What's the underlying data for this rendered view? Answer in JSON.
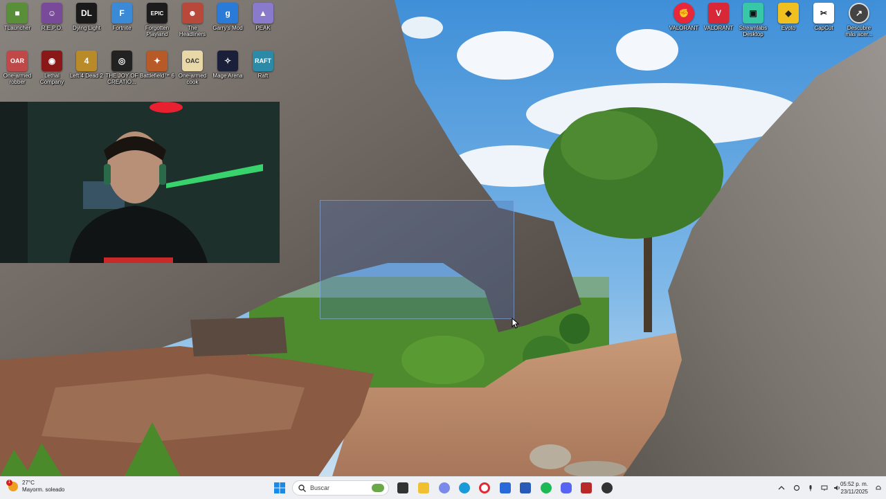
{
  "desktop": {
    "icons": [
      {
        "label": "TLauncher",
        "icon": "tlauncher-icon",
        "color": "#5a8f3a"
      },
      {
        "label": "R.E.P.O.",
        "icon": "repo-icon",
        "color": "#7a4a9a"
      },
      {
        "label": "Dying Light",
        "icon": "dying-light-icon",
        "color": "#1a1a1a"
      },
      {
        "label": "Fortnite",
        "icon": "fortnite-icon",
        "color": "#3a8ad8"
      },
      {
        "label": "Forgotten\nPlayland",
        "icon": "forgotten-playland-icon",
        "color": "#1c1c1c"
      },
      {
        "label": "The\nHeadliners",
        "icon": "the-headliners-icon",
        "color": "#b8483a"
      },
      {
        "label": "Garry's Mod",
        "icon": "garrys-mod-icon",
        "color": "#2a7ad8"
      },
      {
        "label": "PEAK",
        "icon": "peak-icon",
        "color": "#8a7acc"
      },
      {
        "label": "One-armed\nrobber",
        "icon": "one-armed-robber-icon",
        "color": "#c04848"
      },
      {
        "label": "Lethal\nCompany",
        "icon": "lethal-company-icon",
        "color": "#8a1818"
      },
      {
        "label": "Left 4 Dead 2",
        "icon": "left4dead2-icon",
        "color": "#b88a28"
      },
      {
        "label": "THE JOY OF\nCREATIO...",
        "icon": "joy-of-creation-icon",
        "color": "#222222"
      },
      {
        "label": "Battlefield™ 6",
        "icon": "battlefield6-icon",
        "color": "#b85a28"
      },
      {
        "label": "One-armed\ncook",
        "icon": "one-armed-cook-icon",
        "color": "#e8d8a8"
      },
      {
        "label": "Mage Arena",
        "icon": "mage-arena-icon",
        "color": "#1a1f3a"
      },
      {
        "label": "Raft",
        "icon": "raft-icon",
        "color": "#2a8aa8"
      }
    ],
    "right_icons": [
      {
        "label": "VALORANT",
        "icon": "riot-client-icon",
        "color": "#e8283a"
      },
      {
        "label": "VALORANT",
        "icon": "valorant-icon",
        "color": "#d82838"
      },
      {
        "label": "Streamlabs\nDesktop",
        "icon": "streamlabs-icon",
        "color": "#38c8a8"
      },
      {
        "label": "Evoto",
        "icon": "evoto-icon",
        "color": "#f0c020"
      },
      {
        "label": "CapCut",
        "icon": "capcut-icon",
        "color": "#ffffff"
      },
      {
        "label": "Descubre\nmás acer...",
        "icon": "discover-icon",
        "color": "#444444"
      }
    ]
  },
  "taskbar": {
    "weather": {
      "temperature": "27°C",
      "condition": "Mayorm. soleado",
      "badge": "1"
    },
    "search_placeholder": "Buscar",
    "apps": [
      {
        "icon": "file-explorer-icon",
        "color": "#f0c030"
      },
      {
        "icon": "copilot-icon",
        "color": "#7a8ae8"
      },
      {
        "icon": "edge-icon",
        "color": "#1a9ad8"
      },
      {
        "icon": "opera-icon",
        "color": "#e02a38"
      },
      {
        "icon": "store-icon",
        "color": "#2a6ad8"
      },
      {
        "icon": "word-icon",
        "color": "#2a5ab8"
      },
      {
        "icon": "spotify-icon",
        "color": "#1db954"
      },
      {
        "icon": "discord-icon",
        "color": "#5865f2"
      },
      {
        "icon": "capture-app-icon",
        "color": "#b82a2a"
      },
      {
        "icon": "roblox-app-icon",
        "color": "#333333"
      }
    ],
    "clock": {
      "time": "05:52 p. m.",
      "date": "23/11/2025"
    }
  }
}
